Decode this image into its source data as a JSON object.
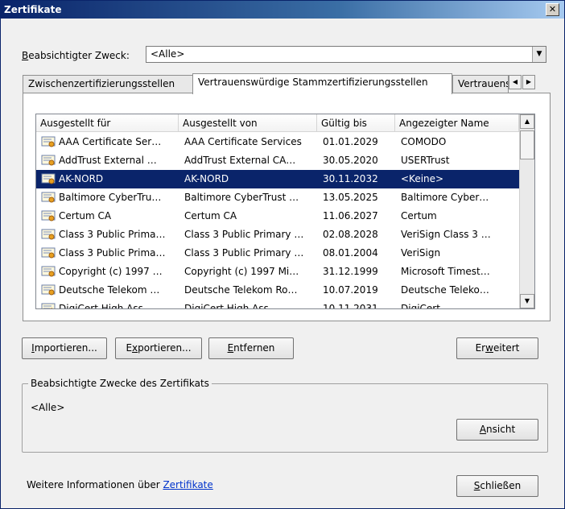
{
  "window": {
    "title": "Zertifikate",
    "close_glyph": "✕"
  },
  "purpose": {
    "label_prefix": "B",
    "label_rest": "eabsichtigter Zweck:",
    "selected": "<Alle>"
  },
  "tabs": [
    {
      "label": "Zwischenzertifizierungsstellen"
    },
    {
      "label": "Vertrauenswürdige Stammzertifizierungsstellen"
    },
    {
      "label": "Vertrauenswürdige Herausgeber"
    }
  ],
  "columns": [
    "Ausgestellt für",
    "Ausgestellt von",
    "Gültig bis",
    "Angezeigter Name"
  ],
  "rows": [
    {
      "issued_to": "AAA Certificate Ser…",
      "issued_by": "AAA Certificate Services",
      "valid_until": "01.01.2029",
      "friendly": "COMODO"
    },
    {
      "issued_to": "AddTrust External …",
      "issued_by": "AddTrust External CA…",
      "valid_until": "30.05.2020",
      "friendly": "USERTrust"
    },
    {
      "issued_to": "AK-NORD",
      "issued_by": "AK-NORD",
      "valid_until": "30.11.2032",
      "friendly": "<Keine>"
    },
    {
      "issued_to": "Baltimore CyberTru…",
      "issued_by": "Baltimore CyberTrust …",
      "valid_until": "13.05.2025",
      "friendly": "Baltimore Cyber…"
    },
    {
      "issued_to": "Certum CA",
      "issued_by": "Certum CA",
      "valid_until": "11.06.2027",
      "friendly": "Certum"
    },
    {
      "issued_to": "Class 3 Public Prima…",
      "issued_by": "Class 3 Public Primary …",
      "valid_until": "02.08.2028",
      "friendly": "VeriSign Class 3 …"
    },
    {
      "issued_to": "Class 3 Public Prima…",
      "issued_by": "Class 3 Public Primary …",
      "valid_until": "08.01.2004",
      "friendly": "VeriSign"
    },
    {
      "issued_to": "Copyright (c) 1997 …",
      "issued_by": "Copyright (c) 1997 Mi…",
      "valid_until": "31.12.1999",
      "friendly": "Microsoft Timest…"
    },
    {
      "issued_to": "Deutsche Telekom …",
      "issued_by": "Deutsche Telekom Ro…",
      "valid_until": "10.07.2019",
      "friendly": "Deutsche Teleko…"
    },
    {
      "issued_to": "DigiCert High Ass…",
      "issued_by": "DigiCert High Ass…",
      "valid_until": "10.11.2031",
      "friendly": "DigiCert"
    }
  ],
  "selected_row": 2,
  "buttons": {
    "import": {
      "u": "I",
      "rest": "mportieren..."
    },
    "export": {
      "pre": "E",
      "u": "x",
      "rest": "portieren..."
    },
    "remove": {
      "u": "E",
      "rest": "ntfernen"
    },
    "advanced": {
      "pre": "Er",
      "u": "w",
      "rest": "eitert"
    },
    "view": {
      "u": "A",
      "rest": "nsicht"
    },
    "close": {
      "u": "S",
      "rest": "chließen"
    }
  },
  "purposes_group": {
    "title": "Beabsichtigte Zwecke des Zertifikats",
    "value": "<Alle>"
  },
  "footer": {
    "text": "Weitere Informationen über ",
    "link": "Zertifikate"
  },
  "colors": {
    "selection": "#0a246a",
    "link": "#0033cc"
  },
  "icons": {
    "row_icon": "certificate-icon",
    "combo": "chevron-down-icon"
  }
}
